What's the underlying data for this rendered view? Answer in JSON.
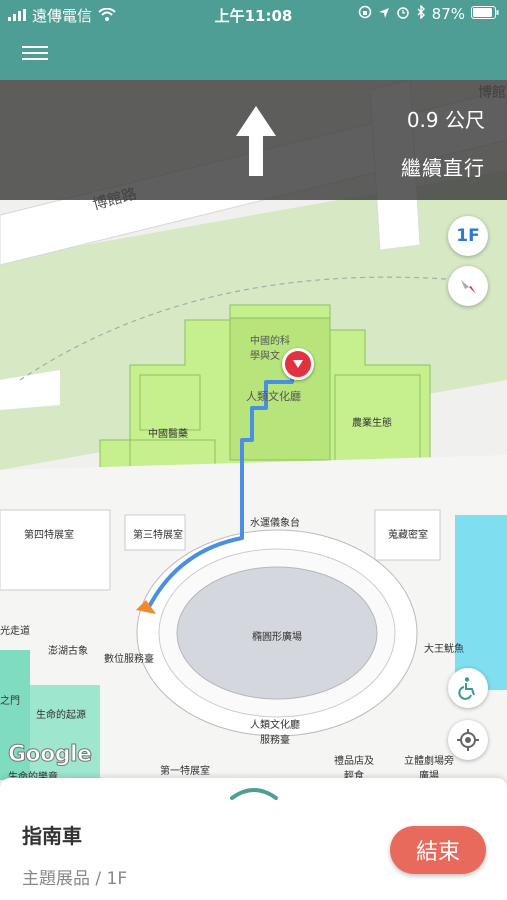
{
  "status_bar": {
    "carrier": "遠傳電信",
    "time": "上午11:08",
    "battery": "87%"
  },
  "navigation": {
    "distance": "0.9 公尺",
    "instruction": "繼續直行"
  },
  "map_controls": {
    "floor": "1F"
  },
  "map_labels": {
    "road": "博館路",
    "road_edge": "博館",
    "chinese_science": "中國的科學與文",
    "human_culture": "人類文化廳",
    "chinese_medicine": "中國醫藥",
    "agri": "農業生態",
    "water_clock": "水運儀象台",
    "gallery4": "第四特展室",
    "gallery3": "第三特展室",
    "treasure": "蒐藏密室",
    "oval_plaza": "橢圓形廣場",
    "digital_service": "數位服務臺",
    "penghu": "澎湖古象",
    "light": "光走道",
    "squid": "大王魷魚",
    "life_source": "生命的起源",
    "gate": "之門",
    "culture_service": "人類文化廳服務臺",
    "gallery1": "第一特展室",
    "gift_shop": "禮品店及輕食",
    "theater": "立體劇場旁廣場",
    "bottom_left": "生命的樂章"
  },
  "branding": {
    "google": "Google"
  },
  "bottom_sheet": {
    "title": "指南車",
    "subtitle": "主題展品 / 1F",
    "end_button": "結束"
  },
  "colors": {
    "header": "#4f9e95",
    "route": "#4a90e2",
    "end_button": "#e86a5d",
    "hall_fill": "#c6f08e"
  }
}
